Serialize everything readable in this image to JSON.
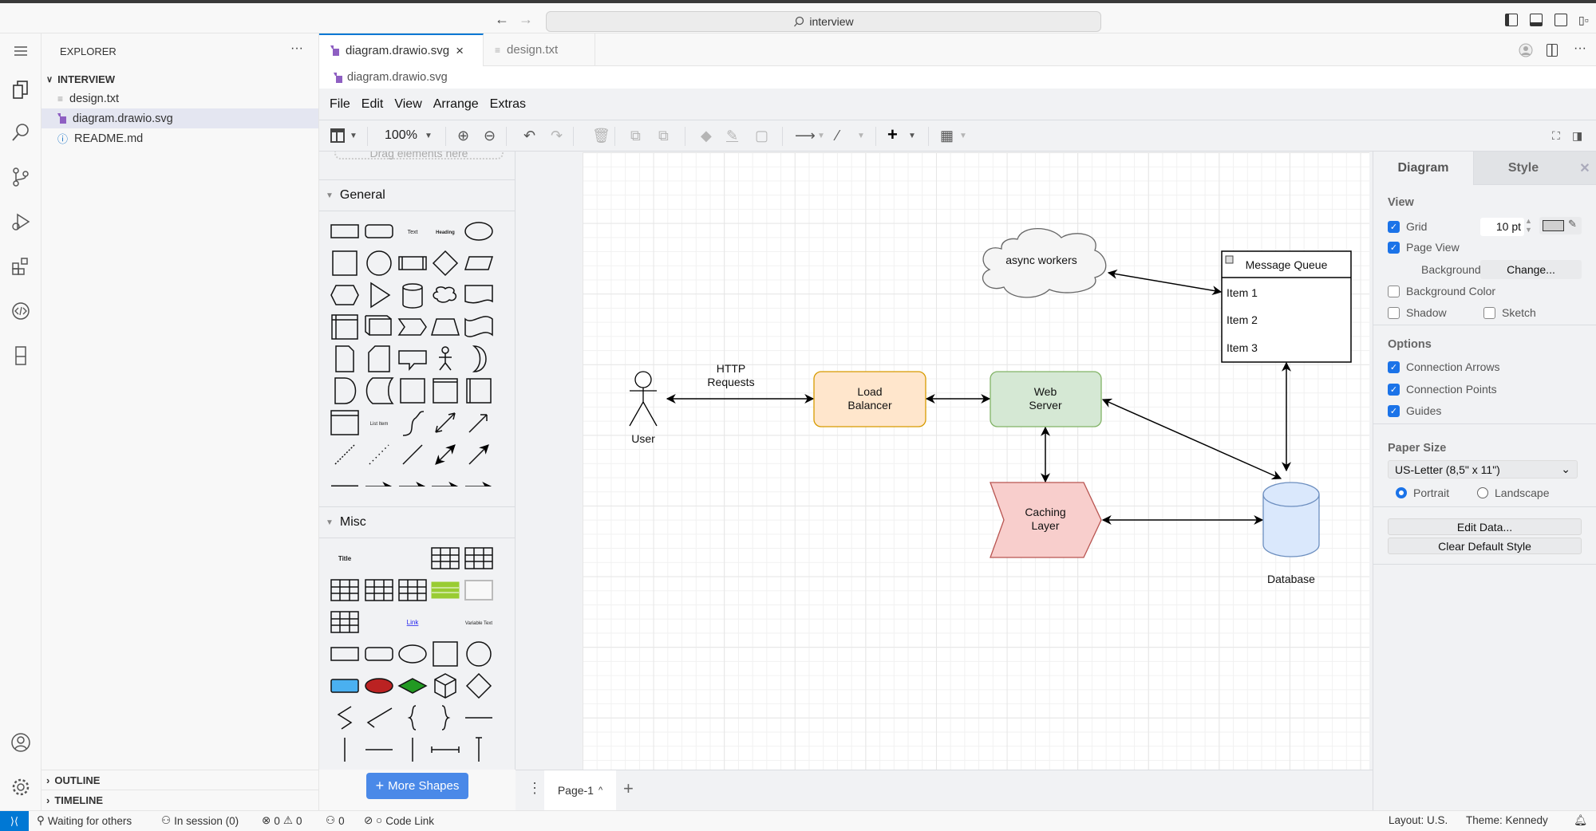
{
  "titlebar": {
    "search_text": "interview",
    "back_icon": "arrow-left-icon",
    "forward_icon": "arrow-right-icon"
  },
  "explorer": {
    "title": "EXPLORER",
    "more": "···",
    "folder": "INTERVIEW",
    "files": [
      {
        "name": "design.txt",
        "icon": "text-file-icon"
      },
      {
        "name": "diagram.drawio.svg",
        "icon": "drawio-file-icon",
        "selected": true
      },
      {
        "name": "README.md",
        "icon": "info-icon"
      }
    ],
    "outline": "OUTLINE",
    "timeline": "TIMELINE"
  },
  "tabs": [
    {
      "label": "diagram.drawio.svg",
      "active": true,
      "close": "×"
    },
    {
      "label": "design.txt",
      "active": false
    }
  ],
  "breadcrumb": "diagram.drawio.svg",
  "menu": [
    "File",
    "Edit",
    "View",
    "Arrange",
    "Extras"
  ],
  "toolbar": {
    "zoom": "100%"
  },
  "shapes": {
    "drag_hint": "Drag elements here",
    "general": "General",
    "misc": "Misc",
    "general_text": {
      "text": "Text",
      "heading": "Heading",
      "list_item": "List Item"
    },
    "misc_text": {
      "title": "Title",
      "link": "Link",
      "variable": "Variable Text"
    },
    "more_shapes": "More Shapes"
  },
  "diagram": {
    "user": "User",
    "http_label_1": "HTTP",
    "http_label_2": "Requests",
    "lb_1": "Load",
    "lb_2": "Balancer",
    "ws_1": "Web",
    "ws_2": "Server",
    "cache_1": "Caching",
    "cache_2": "Layer",
    "cloud": "async workers",
    "mq_title": "Message Queue",
    "mq_items": [
      "Item 1",
      "Item 2",
      "Item 3"
    ],
    "database": "Database",
    "colors": {
      "lb_fill": "#ffe6cc",
      "lb_stroke": "#d79b00",
      "ws_fill": "#d5e8d4",
      "ws_stroke": "#82b366",
      "cache_fill": "#f8cecc",
      "cache_stroke": "#b85450",
      "db_fill": "#dae8fc",
      "db_stroke": "#6c8ebf",
      "cloud_fill": "#f5f5f5",
      "cloud_stroke": "#666666"
    }
  },
  "pagebar": {
    "page": "Page-1"
  },
  "format": {
    "tab_diagram": "Diagram",
    "tab_style": "Style",
    "view": "View",
    "grid": {
      "label": "Grid",
      "checked": true,
      "size": "10 pt"
    },
    "page_view": {
      "label": "Page View",
      "checked": true
    },
    "background": "Background",
    "change": "Change...",
    "bg_color": {
      "label": "Background Color",
      "checked": false
    },
    "shadow": {
      "label": "Shadow",
      "checked": false
    },
    "sketch": {
      "label": "Sketch",
      "checked": false
    },
    "options": "Options",
    "conn_arrows": {
      "label": "Connection Arrows",
      "checked": true
    },
    "conn_points": {
      "label": "Connection Points",
      "checked": true
    },
    "guides": {
      "label": "Guides",
      "checked": true
    },
    "paper_size": "Paper Size",
    "paper_value": "US-Letter (8,5\" x 11\")",
    "portrait": "Portrait",
    "landscape": "Landscape",
    "orientation": "Portrait",
    "edit_data": "Edit Data...",
    "clear_style": "Clear Default Style"
  },
  "status": {
    "waiting": "Waiting for others",
    "session": "In session (0)",
    "errors": "0",
    "warnings": "0",
    "ports": "0",
    "code_link": "Code Link",
    "layout": "Layout: U.S.",
    "theme": "Theme: Kennedy",
    "accent": "#0078d4"
  }
}
